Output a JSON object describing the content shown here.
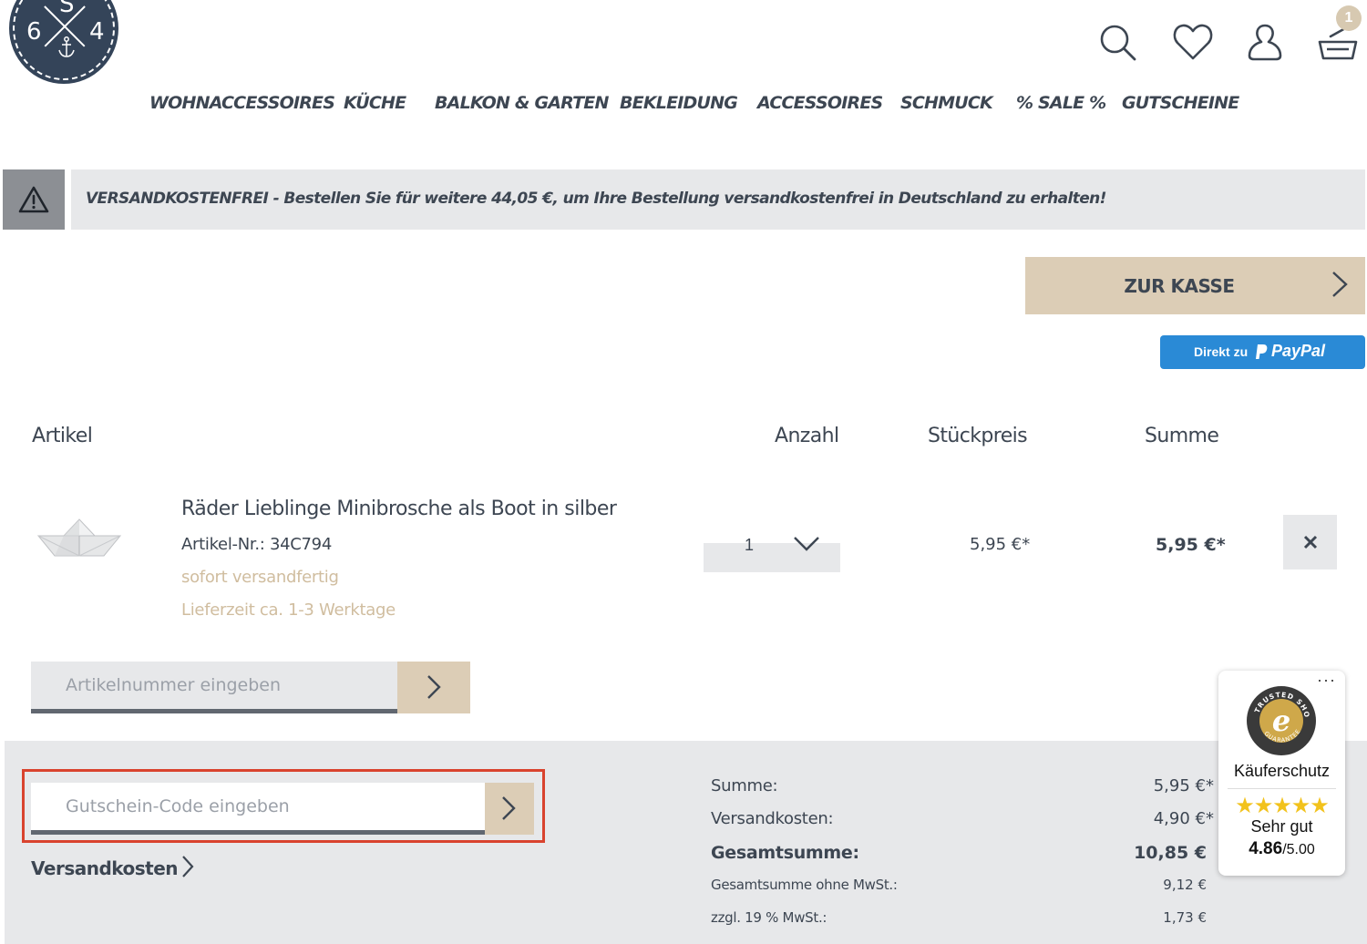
{
  "header": {
    "logo": {
      "top_letter": "S",
      "left_letter": "6",
      "right_letter": "4"
    },
    "icons": [
      "search-icon",
      "heart-icon",
      "user-icon",
      "cart-icon"
    ],
    "cart_count": "1"
  },
  "nav": {
    "items": [
      "WOHNACCESSOIRES",
      "KÜCHE",
      "BALKON & GARTEN",
      "BEKLEIDUNG",
      "ACCESSOIRES",
      "SCHMUCK",
      "% SALE %",
      "GUTSCHEINE"
    ]
  },
  "notice": {
    "icon": "warning-icon",
    "text": "VERSANDKOSTENFREI - Bestellen Sie für weitere 44,05 €, um Ihre Bestellung versandkostenfrei in Deutschland zu erhalten!"
  },
  "checkout": {
    "label": "ZUR KASSE",
    "paypal_prefix": "Direkt zu",
    "paypal_brand": "PayPal"
  },
  "table": {
    "headers": {
      "article": "Artikel",
      "quantity": "Anzahl",
      "unit_price": "Stückpreis",
      "total": "Summe"
    },
    "items": [
      {
        "title": "Räder Lieblinge Minibrosche als Boot in silber",
        "sku": "Artikel-Nr.: 34C794",
        "stock": "sofort versandfertig",
        "delivery": "Lieferzeit ca. 1-3 Werktage",
        "quantity": "1",
        "unit_price": "5,95 €*",
        "total": "5,95 €*"
      }
    ]
  },
  "article_input": {
    "placeholder": "Artikelnummer eingeben"
  },
  "voucher_input": {
    "placeholder": "Gutschein-Code eingeben"
  },
  "shipping_link": "Versandkosten",
  "summary": {
    "subtotal_label": "Summe:",
    "subtotal_value": "5,95 €*",
    "shipping_label": "Versandkosten:",
    "shipping_value": "4,90 €*",
    "grand_total_label": "Gesamtsumme:",
    "grand_total_value": "10,85 €",
    "net_label": "Gesamtsumme ohne MwSt.:",
    "net_value": "9,12 €",
    "vat_label": "zzgl. 19 % MwSt.:",
    "vat_value": "1,73 €"
  },
  "trusted_shops": {
    "menu": "···",
    "seal_text": "TRUSTED SHOPS GUARANTEE",
    "title": "Käuferschutz",
    "stars": "★★★★★",
    "rating_text": "Sehr gut",
    "score": "4.86",
    "score_max": "/5.00",
    "colors": {
      "stars": "#f2c21c",
      "seal": "#cfa84a"
    }
  },
  "colors": {
    "brand_navy": "#344459",
    "accent_beige": "#dccdb6",
    "light_gray": "#e7e8ea",
    "paypal_blue": "#2a8ad6",
    "highlight_red": "#d9432e"
  }
}
